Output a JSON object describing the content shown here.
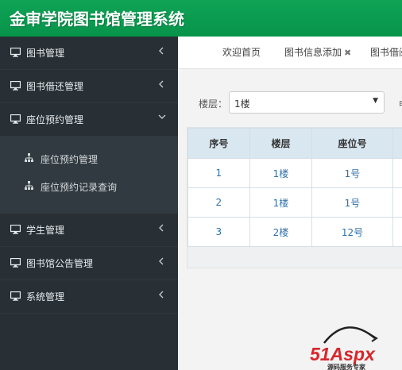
{
  "app": {
    "title": "金审学院图书馆管理系统"
  },
  "sidebar": {
    "items": [
      {
        "label": "图书管理",
        "expanded": false
      },
      {
        "label": "图书借还管理",
        "expanded": false
      },
      {
        "label": "座位预约管理",
        "expanded": true,
        "children": [
          {
            "label": "座位预约管理"
          },
          {
            "label": "座位预约记录查询"
          }
        ]
      },
      {
        "label": "学生管理",
        "expanded": false
      },
      {
        "label": "图书馆公告管理",
        "expanded": false
      },
      {
        "label": "系统管理",
        "expanded": false
      }
    ]
  },
  "tabs": [
    {
      "label": "欢迎首页",
      "closable": false
    },
    {
      "label": "图书信息添加",
      "closable": true,
      "close_glyph": "✖"
    },
    {
      "label": "图书借阅",
      "closable": false
    }
  ],
  "filter": {
    "label": "楼层：",
    "selected": "1楼",
    "clipped_text": "申"
  },
  "table": {
    "headers": [
      "序号",
      "楼层",
      "座位号"
    ],
    "rows": [
      [
        "1",
        "1楼",
        "1号"
      ],
      [
        "2",
        "1楼",
        "1号"
      ],
      [
        "3",
        "2楼",
        "12号"
      ]
    ]
  },
  "watermark": {
    "brand": "51Aspx",
    "tagline": "源码服务专家"
  },
  "colors": {
    "header": "#0a9c50",
    "sidebar": "#283036",
    "table_header": "#d9e7f1",
    "link": "#3071a9"
  }
}
